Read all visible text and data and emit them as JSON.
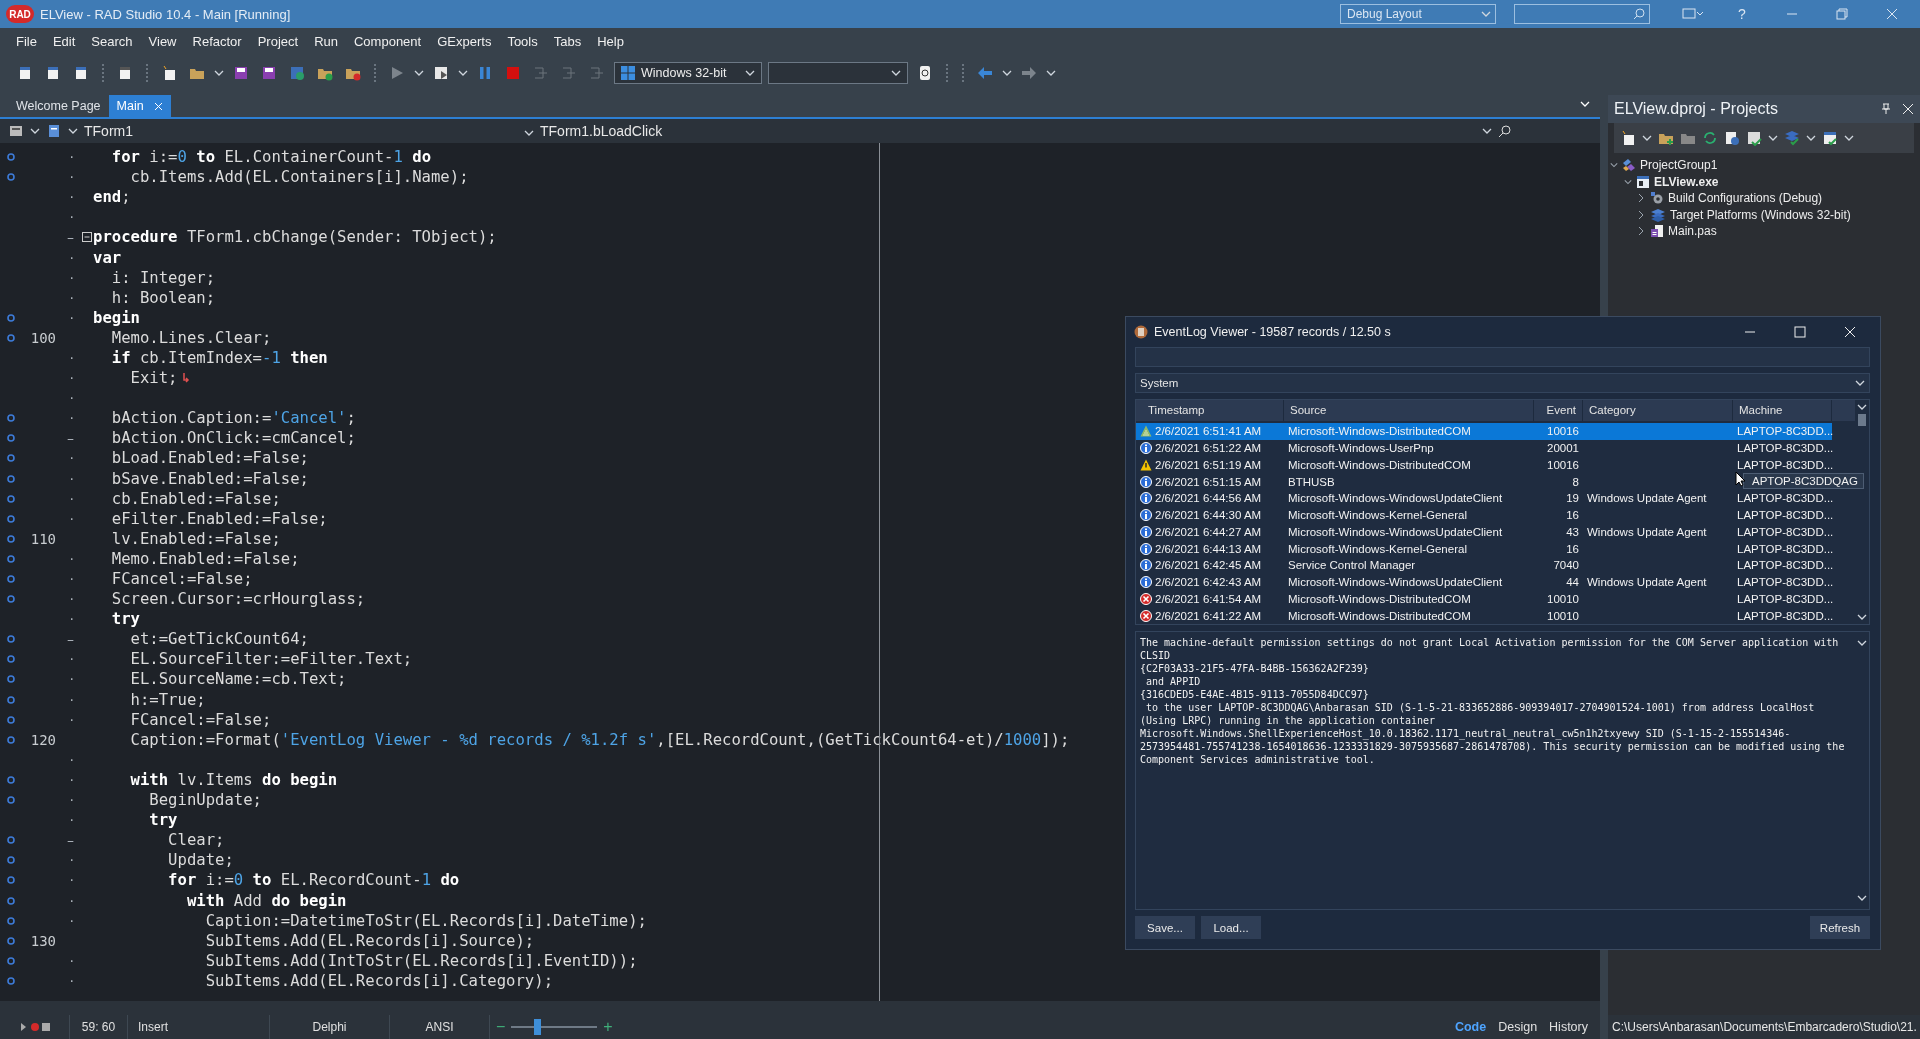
{
  "window": {
    "title": "ELView - RAD Studio 10.4 - Main [Running]",
    "app_badge": "RAD",
    "layout": "Debug Layout",
    "help": "?"
  },
  "menu": [
    "File",
    "Edit",
    "Search",
    "View",
    "Refactor",
    "Project",
    "Run",
    "Component",
    "GExperts",
    "Tools",
    "Tabs",
    "Help"
  ],
  "toolbar": {
    "platform": "Windows 32-bit"
  },
  "editor_tabs": [
    {
      "label": "Welcome Page",
      "selected": false
    },
    {
      "label": "Main",
      "selected": true
    }
  ],
  "editor_header": {
    "class": "TForm1",
    "method": "TForm1.bLoadClick"
  },
  "code_lines": [
    {
      "gutter": "·",
      "compiled": true,
      "code": [
        {
          "kind": "kw",
          "text": "  for"
        },
        {
          "kind": "plain",
          "text": " i:="
        },
        {
          "kind": "num",
          "text": "0"
        },
        {
          "kind": "kw",
          "text": " to"
        },
        {
          "kind": "plain",
          "text": " EL.ContainerCount-"
        },
        {
          "kind": "num",
          "text": "1"
        },
        {
          "kind": "kw",
          "text": " do"
        }
      ]
    },
    {
      "gutter": "·",
      "compiled": true,
      "code": [
        {
          "kind": "plain",
          "text": "    cb.Items.Add(EL.Containers[i].Name);"
        }
      ]
    },
    {
      "gutter": "·",
      "compiled": false,
      "code": [
        {
          "kind": "kw",
          "text": "end"
        },
        {
          "kind": "plain",
          "text": ";"
        }
      ]
    },
    {
      "gutter": "·",
      "compiled": false
    },
    {
      "gutter": "–",
      "compiled": false,
      "fold": true,
      "code": [
        {
          "kind": "kw",
          "text": "procedure"
        },
        {
          "kind": "plain",
          "text": " TForm1.cbChange(Sender: TObject);"
        }
      ]
    },
    {
      "gutter": "·",
      "compiled": false,
      "code": [
        {
          "kind": "kw",
          "text": "var"
        }
      ]
    },
    {
      "gutter": "·",
      "compiled": false,
      "code": [
        {
          "kind": "plain",
          "text": "  i: Integer;"
        }
      ]
    },
    {
      "gutter": "·",
      "compiled": false,
      "code": [
        {
          "kind": "plain",
          "text": "  h: Boolean;"
        }
      ]
    },
    {
      "gutter": "·",
      "compiled": true,
      "code": [
        {
          "kind": "kw",
          "text": "begin"
        }
      ]
    },
    {
      "gutter": "100",
      "compiled": true,
      "code": [
        {
          "kind": "plain",
          "text": "  Memo.Lines.Clear;"
        }
      ]
    },
    {
      "gutter": "·",
      "compiled": false,
      "code": [
        {
          "kind": "kw",
          "text": "  if"
        },
        {
          "kind": "plain",
          "text": " cb.ItemIndex="
        },
        {
          "kind": "num",
          "text": "-1"
        },
        {
          "kind": "kw",
          "text": " then"
        }
      ]
    },
    {
      "gutter": "·",
      "compiled": false,
      "return_marker": true,
      "code": [
        {
          "kind": "plain",
          "text": "    Exit;"
        }
      ]
    },
    {
      "gutter": "·",
      "compiled": false
    },
    {
      "gutter": "·",
      "compiled": true,
      "code": [
        {
          "kind": "plain",
          "text": "  bAction.Caption:="
        },
        {
          "kind": "str",
          "text": "'Cancel'"
        },
        {
          "kind": "plain",
          "text": ";"
        }
      ]
    },
    {
      "gutter": "–",
      "compiled": true,
      "code": [
        {
          "kind": "plain",
          "text": "  bAction.OnClick:=cmCancel;"
        }
      ]
    },
    {
      "gutter": "·",
      "compiled": true,
      "code": [
        {
          "kind": "plain",
          "text": "  bLoad.Enabled:=False;"
        }
      ]
    },
    {
      "gutter": "·",
      "compiled": true,
      "code": [
        {
          "kind": "plain",
          "text": "  bSave.Enabled:=False;"
        }
      ]
    },
    {
      "gutter": "·",
      "compiled": true,
      "code": [
        {
          "kind": "plain",
          "text": "  cb.Enabled:=False;"
        }
      ]
    },
    {
      "gutter": "·",
      "compiled": true,
      "code": [
        {
          "kind": "plain",
          "text": "  eFilter.Enabled:=False;"
        }
      ]
    },
    {
      "gutter": "110",
      "compiled": true,
      "code": [
        {
          "kind": "plain",
          "text": "  lv.Enabled:=False;"
        }
      ]
    },
    {
      "gutter": "·",
      "compiled": true,
      "code": [
        {
          "kind": "plain",
          "text": "  Memo.Enabled:=False;"
        }
      ]
    },
    {
      "gutter": "·",
      "compiled": true,
      "code": [
        {
          "kind": "plain",
          "text": "  FCancel:=False;"
        }
      ]
    },
    {
      "gutter": "·",
      "compiled": true,
      "code": [
        {
          "kind": "plain",
          "text": "  Screen.Cursor:=crHourglass;"
        }
      ]
    },
    {
      "gutter": "·",
      "compiled": false,
      "code": [
        {
          "kind": "kw",
          "text": "  try"
        }
      ]
    },
    {
      "gutter": "–",
      "compiled": true,
      "code": [
        {
          "kind": "plain",
          "text": "    et:=GetTickCount64;"
        }
      ]
    },
    {
      "gutter": "·",
      "compiled": true,
      "code": [
        {
          "kind": "plain",
          "text": "    EL.SourceFilter:=eFilter.Text;"
        }
      ]
    },
    {
      "gutter": "·",
      "compiled": true,
      "code": [
        {
          "kind": "plain",
          "text": "    EL.SourceName:=cb.Text;"
        }
      ]
    },
    {
      "gutter": "·",
      "compiled": true,
      "code": [
        {
          "kind": "plain",
          "text": "    h:=True;"
        }
      ]
    },
    {
      "gutter": "·",
      "compiled": true,
      "code": [
        {
          "kind": "plain",
          "text": "    FCancel:=False;"
        }
      ]
    },
    {
      "gutter": "120",
      "compiled": true,
      "code": [
        {
          "kind": "plain",
          "text": "    Caption:=Format("
        },
        {
          "kind": "str",
          "text": "'EventLog Viewer - %d records / %1.2f s'"
        },
        {
          "kind": "plain",
          "text": ",[EL.RecordCount,(GetTickCount64-et)/"
        },
        {
          "kind": "num",
          "text": "1000"
        },
        {
          "kind": "plain",
          "text": "]);"
        }
      ]
    },
    {
      "gutter": "·",
      "compiled": false
    },
    {
      "gutter": "·",
      "compiled": true,
      "code": [
        {
          "kind": "kw",
          "text": "    with"
        },
        {
          "kind": "plain",
          "text": " lv.Items "
        },
        {
          "kind": "kw",
          "text": "do begin"
        }
      ]
    },
    {
      "gutter": "·",
      "compiled": true,
      "code": [
        {
          "kind": "plain",
          "text": "      BeginUpdate;"
        }
      ]
    },
    {
      "gutter": "·",
      "compiled": false,
      "code": [
        {
          "kind": "kw",
          "text": "      try"
        }
      ]
    },
    {
      "gutter": "–",
      "compiled": true,
      "code": [
        {
          "kind": "plain",
          "text": "        Clear;"
        }
      ]
    },
    {
      "gutter": "·",
      "compiled": true,
      "code": [
        {
          "kind": "plain",
          "text": "        Update;"
        }
      ]
    },
    {
      "gutter": "·",
      "compiled": true,
      "code": [
        {
          "kind": "kw",
          "text": "        for"
        },
        {
          "kind": "plain",
          "text": " i:="
        },
        {
          "kind": "num",
          "text": "0"
        },
        {
          "kind": "kw",
          "text": " to"
        },
        {
          "kind": "plain",
          "text": " EL.RecordCount-"
        },
        {
          "kind": "num",
          "text": "1"
        },
        {
          "kind": "kw",
          "text": " do"
        }
      ]
    },
    {
      "gutter": "·",
      "compiled": true,
      "code": [
        {
          "kind": "kw",
          "text": "          with"
        },
        {
          "kind": "plain",
          "text": " Add "
        },
        {
          "kind": "kw",
          "text": "do begin"
        }
      ]
    },
    {
      "gutter": "·",
      "compiled": true,
      "code": [
        {
          "kind": "plain",
          "text": "            Caption:=DatetimeToStr(EL.Records[i].DateTime);"
        }
      ]
    },
    {
      "gutter": "130",
      "compiled": true,
      "code": [
        {
          "kind": "plain",
          "text": "            SubItems.Add(EL.Records[i].Source);"
        }
      ]
    },
    {
      "gutter": "·",
      "compiled": true,
      "code": [
        {
          "kind": "plain",
          "text": "            SubItems.Add(IntToStr(EL.Records[i].EventID));"
        }
      ]
    },
    {
      "gutter": "·",
      "compiled": true,
      "code": [
        {
          "kind": "plain",
          "text": "            SubItems.Add(EL.Records[i].Category);"
        }
      ]
    }
  ],
  "status_bar": {
    "position": "59: 60",
    "mode": "Insert",
    "language": "Delphi",
    "encoding": "ANSI",
    "zoom_minus": "−",
    "zoom_plus": "+",
    "zoom": {
      "level": 0.3
    },
    "view_tabs": [
      {
        "label": "Code",
        "selected": true
      },
      {
        "label": "Design",
        "selected": false
      },
      {
        "label": "History",
        "selected": false
      }
    ]
  },
  "projects_panel": {
    "title": "ELView.dproj - Projects",
    "path": "C:\\Users\\Anbarasan\\Documents\\Embarcadero\\Studio\\21.",
    "tree": [
      {
        "label": "ProjectGroup1",
        "kind": "group",
        "expanded": true,
        "children": [
          {
            "label": "ELView.exe",
            "kind": "project",
            "expanded": true,
            "children": [
              {
                "label": "Build Configurations (Debug)",
                "kind": "config",
                "expanded": false
              },
              {
                "label": "Target Platforms (Windows 32-bit)",
                "kind": "platforms",
                "expanded": false
              },
              {
                "label": "Main.pas",
                "kind": "unit",
                "expanded": false
              }
            ]
          }
        ]
      }
    ]
  },
  "eventlog_window": {
    "title": "EventLog Viewer - 19587 records / 12.50 s",
    "log": "System",
    "columns": [
      "Timestamp",
      "Source",
      "Event",
      "Category",
      "Machine"
    ],
    "rows": [
      {
        "kind": "audit",
        "selected": true,
        "cells": [
          "2/6/2021 6:51:41 AM",
          "Microsoft-Windows-DistributedCOM",
          "10016",
          null,
          "LAPTOP-8C3DD..."
        ]
      },
      {
        "kind": "info",
        "selected": false,
        "cells": [
          "2/6/2021 6:51:22 AM",
          "Microsoft-Windows-UserPnp",
          "20001",
          null,
          "LAPTOP-8C3DD..."
        ]
      },
      {
        "kind": "warning",
        "selected": false,
        "cells": [
          "2/6/2021 6:51:19 AM",
          "Microsoft-Windows-DistributedCOM",
          "10016",
          null,
          "LAPTOP-8C3DD..."
        ]
      },
      {
        "kind": "info",
        "selected": false,
        "cells": [
          "2/6/2021 6:51:15 AM",
          "BTHUSB",
          "8"
        ],
        "tooltip": "APTOP-8C3DDQAG"
      },
      {
        "kind": "info",
        "selected": false,
        "cells": [
          "2/6/2021 6:44:56 AM",
          "Microsoft-Windows-WindowsUpdateClient",
          "19",
          "Windows Update Agent",
          "LAPTOP-8C3DD..."
        ]
      },
      {
        "kind": "info",
        "selected": false,
        "cells": [
          "2/6/2021 6:44:30 AM",
          "Microsoft-Windows-Kernel-General",
          "16",
          null,
          "LAPTOP-8C3DD..."
        ]
      },
      {
        "kind": "info",
        "selected": false,
        "cells": [
          "2/6/2021 6:44:27 AM",
          "Microsoft-Windows-WindowsUpdateClient",
          "43",
          "Windows Update Agent",
          "LAPTOP-8C3DD..."
        ]
      },
      {
        "kind": "info",
        "selected": false,
        "cells": [
          "2/6/2021 6:44:13 AM",
          "Microsoft-Windows-Kernel-General",
          "16",
          null,
          "LAPTOP-8C3DD..."
        ]
      },
      {
        "kind": "info",
        "selected": false,
        "cells": [
          "2/6/2021 6:42:45 AM",
          "Service Control Manager",
          "7040",
          null,
          "LAPTOP-8C3DD..."
        ]
      },
      {
        "kind": "info",
        "selected": false,
        "cells": [
          "2/6/2021 6:42:43 AM",
          "Microsoft-Windows-WindowsUpdateClient",
          "44",
          "Windows Update Agent",
          "LAPTOP-8C3DD..."
        ]
      },
      {
        "kind": "error",
        "selected": false,
        "cells": [
          "2/6/2021 6:41:54 AM",
          "Microsoft-Windows-DistributedCOM",
          "10010",
          null,
          "LAPTOP-8C3DD..."
        ]
      },
      {
        "kind": "error",
        "selected": false,
        "cells": [
          "2/6/2021 6:41:22 AM",
          "Microsoft-Windows-DistributedCOM",
          "10010",
          null,
          "LAPTOP-8C3DD..."
        ]
      }
    ],
    "memo": [
      "The machine-default permission settings do not grant Local Activation permission for the COM Server application with",
      "CLSID",
      "{C2F03A33-21F5-47FA-B4BB-156362A2F239}",
      " and APPID",
      "{316CDED5-E4AE-4B15-9113-7055D84DCC97}",
      " to the user LAPTOP-8C3DDQAG\\Anbarasan SID (S-1-5-21-833652886-909394017-2704901524-1001) from address LocalHost",
      "(Using LRPC) running in the application container",
      "Microsoft.Windows.ShellExperienceHost_10.0.18362.1171_neutral_neutral_cw5n1h2txyewy SID (S-1-15-2-155514346-",
      "2573954481-755741238-1654018636-1233331829-3075935687-2861478708). This security permission can be modified using the",
      "Component Services administrative tool."
    ],
    "buttons": [
      "Save...",
      "Load..."
    ],
    "refresh_button": "Refresh"
  }
}
